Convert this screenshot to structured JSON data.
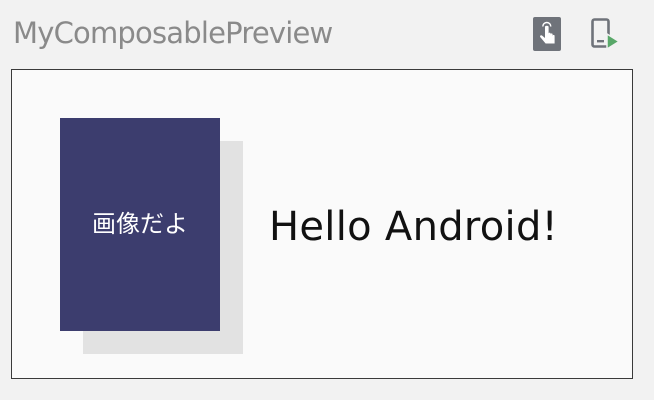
{
  "preview": {
    "title": "MyComposablePreview"
  },
  "toolbar": {
    "interactive_icon": "interactive-mode-hand-icon",
    "deploy_icon": "deploy-to-device-icon"
  },
  "composable": {
    "image_text": "画像だよ",
    "greeting": "Hello Android!"
  },
  "colors": {
    "image_background": "#3c3d6e",
    "image_shadow": "#e2e2e2",
    "frame_background": "#fafafa",
    "deploy_accent": "#59a869",
    "icon_gray": "#6f737a"
  }
}
